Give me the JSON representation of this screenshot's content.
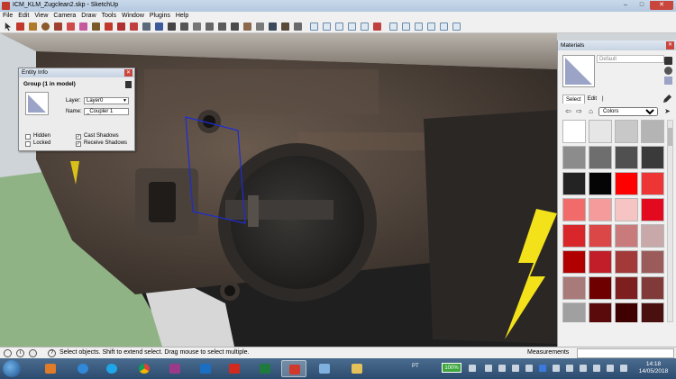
{
  "window": {
    "title": "ICM_KLM_Zugclean2.skp - SketchUp",
    "controls": [
      "–",
      "□",
      "✕"
    ]
  },
  "menu": [
    "File",
    "Edit",
    "View",
    "Camera",
    "Draw",
    "Tools",
    "Window",
    "Plugins",
    "Help"
  ],
  "entity_info": {
    "title": "Entity Info",
    "close": "✕",
    "heading": "Group (1 in model)",
    "layer_label": "Layer:",
    "layer_value": "Layer0",
    "name_label": "Name:",
    "name_value": "_Coupler 1",
    "hidden_label": "Hidden",
    "locked_label": "Locked",
    "cast_shadows_label": "Cast Shadows",
    "receive_shadows_label": "Receive Shadows",
    "hidden_checked": "",
    "locked_checked": "",
    "cast_checked": "✓",
    "receive_checked": "✓"
  },
  "materials": {
    "title": "Materials",
    "close": "✕",
    "material_name": "Default",
    "tab_select": "Select",
    "tab_edit": "Edit",
    "tab_separator": "|",
    "collection": "Colors",
    "nav_back": "⇦",
    "nav_forward": "⇨",
    "nav_home": "⌂",
    "nav_details": "➤",
    "swatches": [
      "#ffffff",
      "#e6e6e6",
      "#c8c8c8",
      "#b4b4b4",
      "#8c8c8c",
      "#6e6e6e",
      "#505050",
      "#3a3a3a",
      "#232323",
      "#050505",
      "#ff0000",
      "#ee3535",
      "#f26b6b",
      "#f59b9b",
      "#f7c4c4",
      "#e3091e",
      "#d9262b",
      "#db4646",
      "#c97a7a",
      "#c8a8a8",
      "#b00000",
      "#c21e2a",
      "#a33a3a",
      "#9c5b5b",
      "#a87a7a",
      "#6e0000",
      "#7e1f1f",
      "#803a3a",
      "#a0a0a0",
      "#5a0a0a",
      "#3e0000",
      "#4a0f0f"
    ]
  },
  "status": {
    "message": "Select objects. Shift to extend select. Drag mouse to select multiple.",
    "measurements_label": "Measurements",
    "info_icon": "i",
    "help_icon": "?"
  },
  "taskbar": {
    "language": "PT",
    "battery": "100%",
    "time": "14:18",
    "date": "14/05/2018"
  }
}
